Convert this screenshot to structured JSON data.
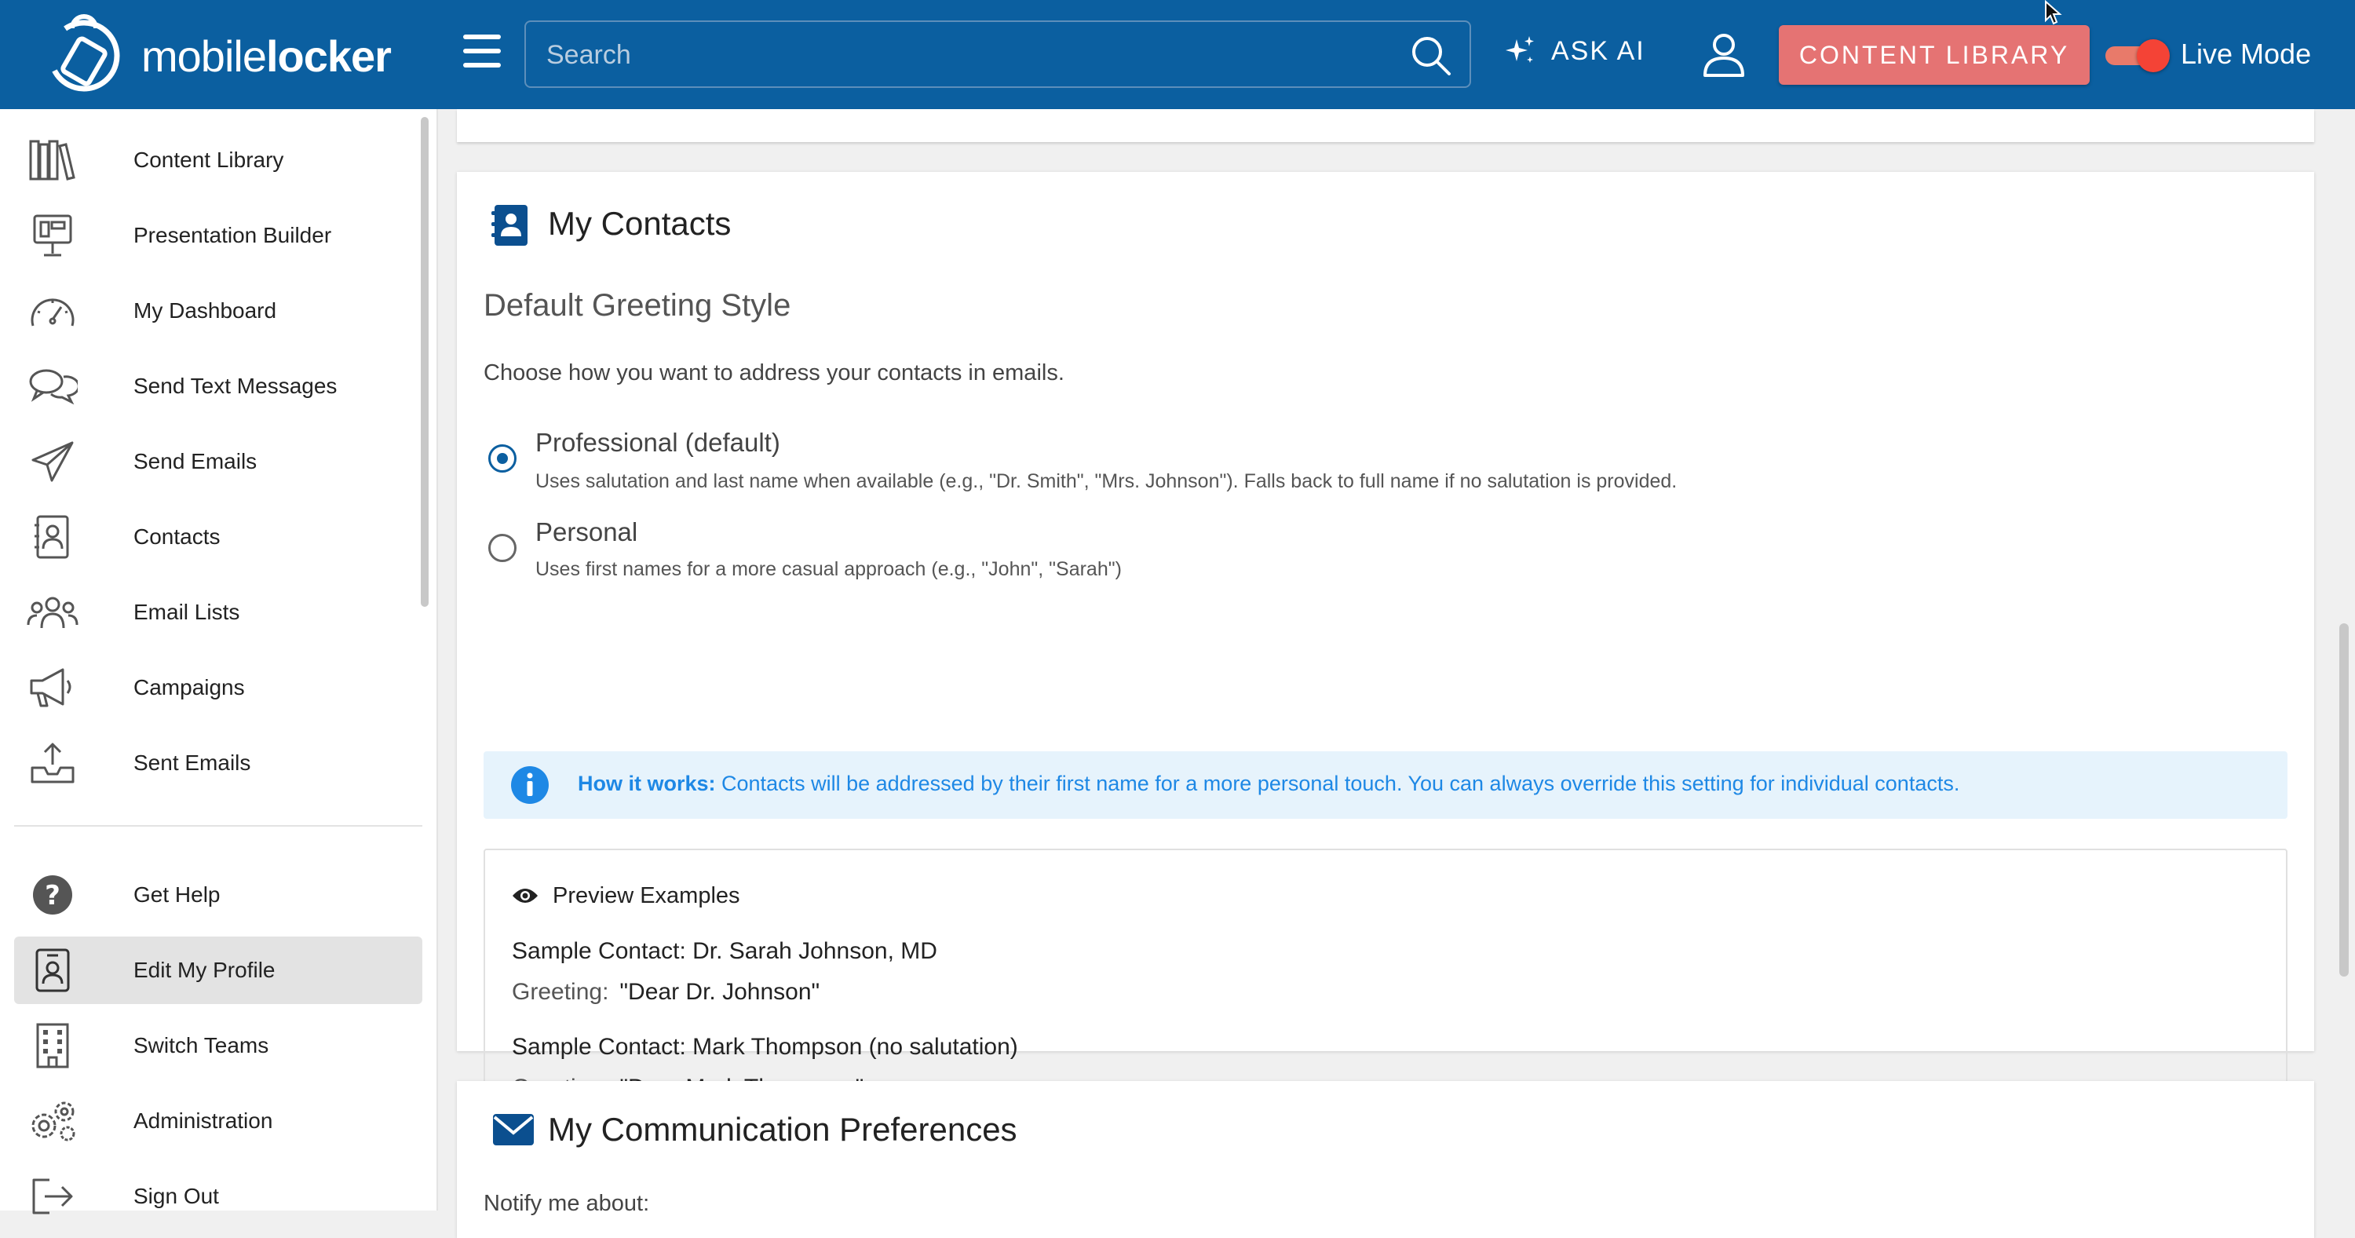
{
  "header": {
    "logo_text_pre": "mobile",
    "logo_text_post": "locker",
    "search_placeholder": "Search",
    "ask_ai": "ASK AI",
    "content_library_btn": "CONTENT LIBRARY",
    "live_mode": "Live Mode",
    "live_mode_on": true
  },
  "sidebar": {
    "items": [
      {
        "label": "Content Library",
        "icon": "books-icon"
      },
      {
        "label": "Presentation Builder",
        "icon": "presentation-icon"
      },
      {
        "label": "My Dashboard",
        "icon": "gauge-icon"
      },
      {
        "label": "Send Text Messages",
        "icon": "chat-bubbles-icon"
      },
      {
        "label": "Send Emails",
        "icon": "paper-plane-icon"
      },
      {
        "label": "Contacts",
        "icon": "contact-card-icon"
      },
      {
        "label": "Email Lists",
        "icon": "people-group-icon"
      },
      {
        "label": "Campaigns",
        "icon": "megaphone-icon"
      },
      {
        "label": "Sent Emails",
        "icon": "tray-upload-icon"
      }
    ],
    "bottom_items": [
      {
        "label": "Get Help",
        "icon": "question-circle-icon"
      },
      {
        "label": "Edit My Profile",
        "icon": "id-badge-icon",
        "active": true
      },
      {
        "label": "Switch Teams",
        "icon": "building-icon"
      },
      {
        "label": "Administration",
        "icon": "gears-icon"
      },
      {
        "label": "Sign Out",
        "icon": "sign-out-icon"
      }
    ]
  },
  "contacts_section": {
    "title": "My Contacts",
    "subheading": "Default Greeting Style",
    "description": "Choose how you want to address your contacts in emails.",
    "options": [
      {
        "label": "Professional (default)",
        "description": "Uses salutation and last name when available (e.g., \"Dr. Smith\", \"Mrs. Johnson\"). Falls back to full name if no salutation is provided.",
        "checked": true
      },
      {
        "label": "Personal",
        "description": "Uses first names for a more casual approach (e.g., \"John\", \"Sarah\")",
        "checked": false
      }
    ],
    "info_bold": "How it works:",
    "info_text": "Contacts will be addressed by their first name for a more personal touch. You can always override this setting for individual contacts.",
    "preview": {
      "title": "Preview Examples",
      "samples": [
        {
          "contact": "Sample Contact: Dr. Sarah Johnson, MD",
          "greeting_label": "Greeting:",
          "greeting": "\"Dear Dr. Johnson\""
        },
        {
          "contact": "Sample Contact: Mark Thompson (no salutation)",
          "greeting_label": "Greeting:",
          "greeting": "\"Dear Mark Thompson\""
        }
      ]
    }
  },
  "communication_section": {
    "title": "My Communication Preferences",
    "notify_label": "Notify me about:"
  },
  "colors": {
    "header_bg": "#0b5fa0",
    "accent_btn": "#e57373",
    "info_bg": "#e6f3fc",
    "info_text": "#1e88e5"
  }
}
